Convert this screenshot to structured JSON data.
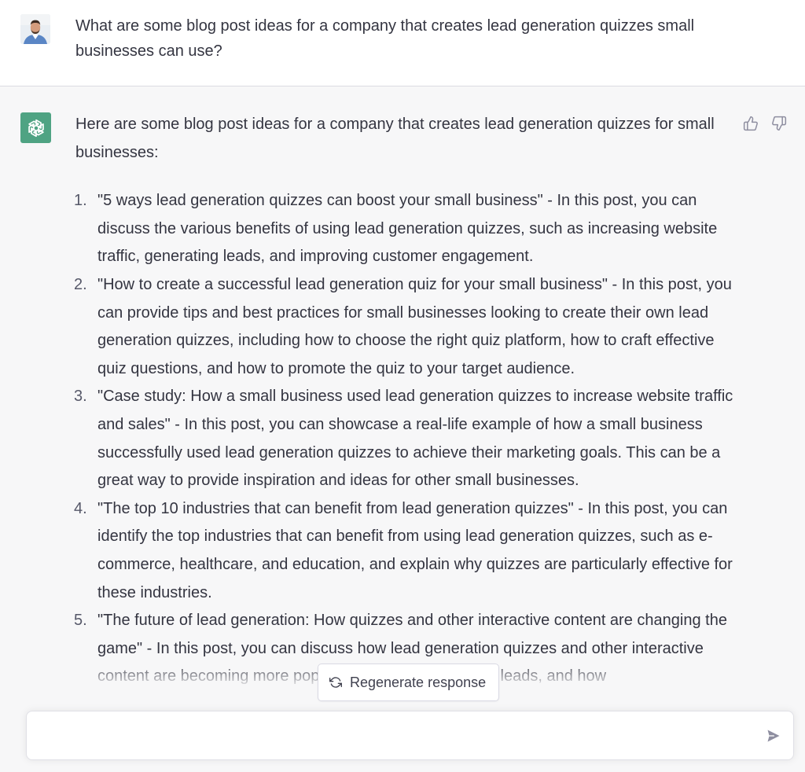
{
  "user_message": {
    "text": "What are some blog post ideas for a company that creates lead generation quizzes small businesses can use?"
  },
  "assistant_message": {
    "intro": "Here are some blog post ideas for a company that creates lead generation quizzes for small businesses:",
    "items": [
      {
        "number": "1.",
        "text": "\"5 ways lead generation quizzes can boost your small business\" - In this post, you can discuss the various benefits of using lead generation quizzes, such as increasing website traffic, generating leads, and improving customer engagement."
      },
      {
        "number": "2.",
        "text": "\"How to create a successful lead generation quiz for your small business\" - In this post, you can provide tips and best practices for small businesses looking to create their own lead generation quizzes, including how to choose the right quiz platform, how to craft effective quiz questions, and how to promote the quiz to your target audience."
      },
      {
        "number": "3.",
        "text": "\"Case study: How a small business used lead generation quizzes to increase website traffic and sales\" - In this post, you can showcase a real-life example of how a small business successfully used lead generation quizzes to achieve their marketing goals. This can be a great way to provide inspiration and ideas for other small businesses."
      },
      {
        "number": "4.",
        "text": "\"The top 10 industries that can benefit from lead generation quizzes\" - In this post, you can identify the top industries that can benefit from using lead generation quizzes, such as e-commerce, healthcare, and education, and explain why quizzes are particularly effective for these industries."
      },
      {
        "number": "5.",
        "text": "\"The future of lead generation: How quizzes and other interactive content are changing the game\" - In this post, you can discuss how lead generation quizzes and other interactive content are becoming more popular as a way to generate leads, and how"
      }
    ]
  },
  "controls": {
    "regenerate_label": "Regenerate response",
    "input_value": ""
  },
  "icons": {
    "avatar": "user-avatar",
    "assistant": "openai-logo-icon",
    "thumbs_up": "thumbs-up-icon",
    "thumbs_down": "thumbs-down-icon",
    "regenerate": "refresh-icon",
    "send": "send-icon"
  },
  "colors": {
    "assistant_logo_bg": "#4fa383",
    "assistant_bg": "#f7f7f8",
    "user_bg": "#ffffff",
    "text": "#343541"
  }
}
